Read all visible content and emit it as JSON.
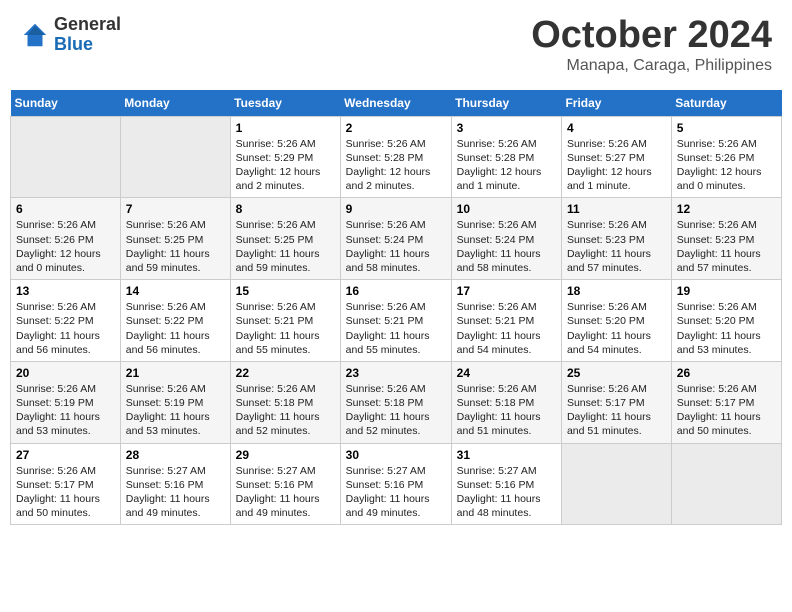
{
  "header": {
    "logo_general": "General",
    "logo_blue": "Blue",
    "month": "October 2024",
    "location": "Manapa, Caraga, Philippines"
  },
  "days_of_week": [
    "Sunday",
    "Monday",
    "Tuesday",
    "Wednesday",
    "Thursday",
    "Friday",
    "Saturday"
  ],
  "weeks": [
    [
      {
        "day": "",
        "content": ""
      },
      {
        "day": "",
        "content": ""
      },
      {
        "day": "1",
        "content": "Sunrise: 5:26 AM\nSunset: 5:29 PM\nDaylight: 12 hours\nand 2 minutes."
      },
      {
        "day": "2",
        "content": "Sunrise: 5:26 AM\nSunset: 5:28 PM\nDaylight: 12 hours\nand 2 minutes."
      },
      {
        "day": "3",
        "content": "Sunrise: 5:26 AM\nSunset: 5:28 PM\nDaylight: 12 hours\nand 1 minute."
      },
      {
        "day": "4",
        "content": "Sunrise: 5:26 AM\nSunset: 5:27 PM\nDaylight: 12 hours\nand 1 minute."
      },
      {
        "day": "5",
        "content": "Sunrise: 5:26 AM\nSunset: 5:26 PM\nDaylight: 12 hours\nand 0 minutes."
      }
    ],
    [
      {
        "day": "6",
        "content": "Sunrise: 5:26 AM\nSunset: 5:26 PM\nDaylight: 12 hours\nand 0 minutes."
      },
      {
        "day": "7",
        "content": "Sunrise: 5:26 AM\nSunset: 5:25 PM\nDaylight: 11 hours\nand 59 minutes."
      },
      {
        "day": "8",
        "content": "Sunrise: 5:26 AM\nSunset: 5:25 PM\nDaylight: 11 hours\nand 59 minutes."
      },
      {
        "day": "9",
        "content": "Sunrise: 5:26 AM\nSunset: 5:24 PM\nDaylight: 11 hours\nand 58 minutes."
      },
      {
        "day": "10",
        "content": "Sunrise: 5:26 AM\nSunset: 5:24 PM\nDaylight: 11 hours\nand 58 minutes."
      },
      {
        "day": "11",
        "content": "Sunrise: 5:26 AM\nSunset: 5:23 PM\nDaylight: 11 hours\nand 57 minutes."
      },
      {
        "day": "12",
        "content": "Sunrise: 5:26 AM\nSunset: 5:23 PM\nDaylight: 11 hours\nand 57 minutes."
      }
    ],
    [
      {
        "day": "13",
        "content": "Sunrise: 5:26 AM\nSunset: 5:22 PM\nDaylight: 11 hours\nand 56 minutes."
      },
      {
        "day": "14",
        "content": "Sunrise: 5:26 AM\nSunset: 5:22 PM\nDaylight: 11 hours\nand 56 minutes."
      },
      {
        "day": "15",
        "content": "Sunrise: 5:26 AM\nSunset: 5:21 PM\nDaylight: 11 hours\nand 55 minutes."
      },
      {
        "day": "16",
        "content": "Sunrise: 5:26 AM\nSunset: 5:21 PM\nDaylight: 11 hours\nand 55 minutes."
      },
      {
        "day": "17",
        "content": "Sunrise: 5:26 AM\nSunset: 5:21 PM\nDaylight: 11 hours\nand 54 minutes."
      },
      {
        "day": "18",
        "content": "Sunrise: 5:26 AM\nSunset: 5:20 PM\nDaylight: 11 hours\nand 54 minutes."
      },
      {
        "day": "19",
        "content": "Sunrise: 5:26 AM\nSunset: 5:20 PM\nDaylight: 11 hours\nand 53 minutes."
      }
    ],
    [
      {
        "day": "20",
        "content": "Sunrise: 5:26 AM\nSunset: 5:19 PM\nDaylight: 11 hours\nand 53 minutes."
      },
      {
        "day": "21",
        "content": "Sunrise: 5:26 AM\nSunset: 5:19 PM\nDaylight: 11 hours\nand 53 minutes."
      },
      {
        "day": "22",
        "content": "Sunrise: 5:26 AM\nSunset: 5:18 PM\nDaylight: 11 hours\nand 52 minutes."
      },
      {
        "day": "23",
        "content": "Sunrise: 5:26 AM\nSunset: 5:18 PM\nDaylight: 11 hours\nand 52 minutes."
      },
      {
        "day": "24",
        "content": "Sunrise: 5:26 AM\nSunset: 5:18 PM\nDaylight: 11 hours\nand 51 minutes."
      },
      {
        "day": "25",
        "content": "Sunrise: 5:26 AM\nSunset: 5:17 PM\nDaylight: 11 hours\nand 51 minutes."
      },
      {
        "day": "26",
        "content": "Sunrise: 5:26 AM\nSunset: 5:17 PM\nDaylight: 11 hours\nand 50 minutes."
      }
    ],
    [
      {
        "day": "27",
        "content": "Sunrise: 5:26 AM\nSunset: 5:17 PM\nDaylight: 11 hours\nand 50 minutes."
      },
      {
        "day": "28",
        "content": "Sunrise: 5:27 AM\nSunset: 5:16 PM\nDaylight: 11 hours\nand 49 minutes."
      },
      {
        "day": "29",
        "content": "Sunrise: 5:27 AM\nSunset: 5:16 PM\nDaylight: 11 hours\nand 49 minutes."
      },
      {
        "day": "30",
        "content": "Sunrise: 5:27 AM\nSunset: 5:16 PM\nDaylight: 11 hours\nand 49 minutes."
      },
      {
        "day": "31",
        "content": "Sunrise: 5:27 AM\nSunset: 5:16 PM\nDaylight: 11 hours\nand 48 minutes."
      },
      {
        "day": "",
        "content": ""
      },
      {
        "day": "",
        "content": ""
      }
    ]
  ]
}
